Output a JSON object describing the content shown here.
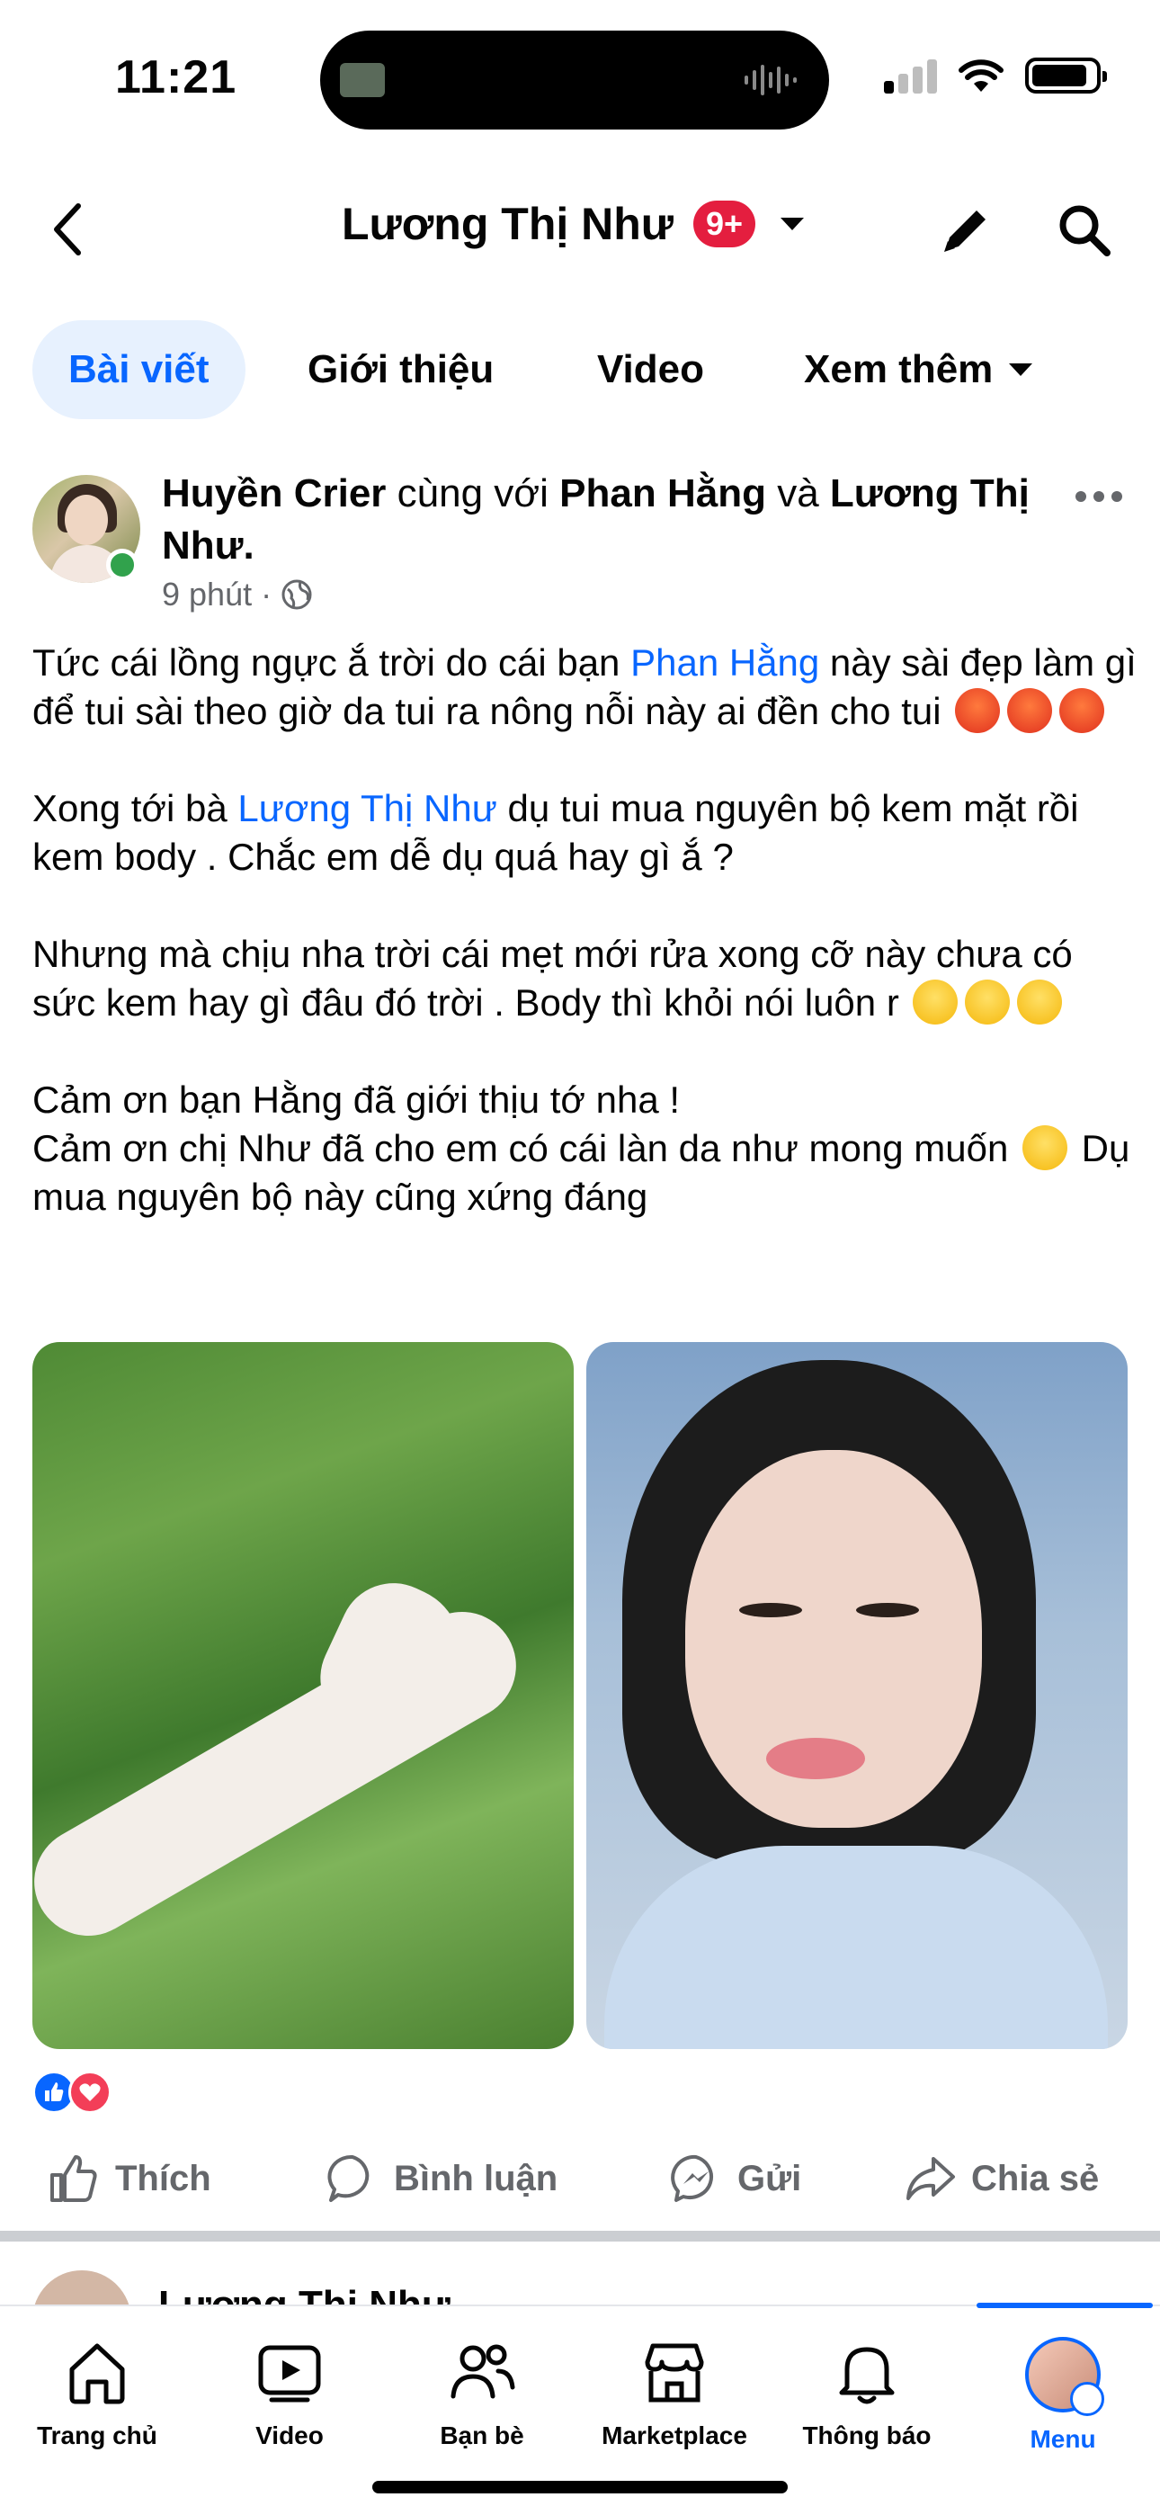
{
  "status_bar": {
    "time": "11:21"
  },
  "header": {
    "title": "Lương Thị Như",
    "badge": "9+"
  },
  "tabs": [
    {
      "label": "Bài viết"
    },
    {
      "label": "Giới thiệu"
    },
    {
      "label": "Video"
    },
    {
      "label": "Xem thêm"
    }
  ],
  "post": {
    "author": "Huyền Crier",
    "with_text": "cùng với",
    "tagged_1": "Phan Hằng",
    "and_text": "và",
    "tagged_2": "Lương Thị Như",
    "time": "9 phút",
    "paragraphs": {
      "p1_a": "Tức cái lồng ngực ắ trời do cái bạn ",
      "p1_mention": "Phan Hằng",
      "p1_b": " này sài đẹp làm gì để tui  sài theo giờ da tui ra nông nỗi này ai đền cho tui",
      "p2_a": "Xong tới bà ",
      "p2_mention": "Lương Thị Như",
      "p2_b": " dụ tui mua nguyên bộ kem mặt rồi kem body . Chắc em dễ dụ quá hay gì ắ  ?",
      "p3": " Nhưng mà chịu nha trời cái mẹt mới rửa xong cỡ này chưa có sức kem hay gì đâu đó  trời . Body thì khỏi nói luôn r",
      "p4": "Cảm ơn  bạn Hằng đã giới thịu tớ nha !",
      "p5_a": "Cảm ơn chị Như đã cho em có  cái làn da  như mong muốn",
      "p5_b": "  Dụ mua nguyên bộ này cũng xứng đáng"
    }
  },
  "actions": {
    "like": "Thích",
    "comment": "Bình luận",
    "send": "Gửi",
    "share": "Chia sẻ"
  },
  "next_post": {
    "author": "Lương Thị Như"
  },
  "bottom_nav": [
    {
      "label": "Trang chủ"
    },
    {
      "label": "Video"
    },
    {
      "label": "Bạn bè"
    },
    {
      "label": "Marketplace"
    },
    {
      "label": "Thông báo"
    },
    {
      "label": "Menu"
    }
  ],
  "colors": {
    "accent": "#0866ff",
    "badge": "#e41e3f",
    "online": "#31a24c",
    "muted": "#65676b"
  }
}
